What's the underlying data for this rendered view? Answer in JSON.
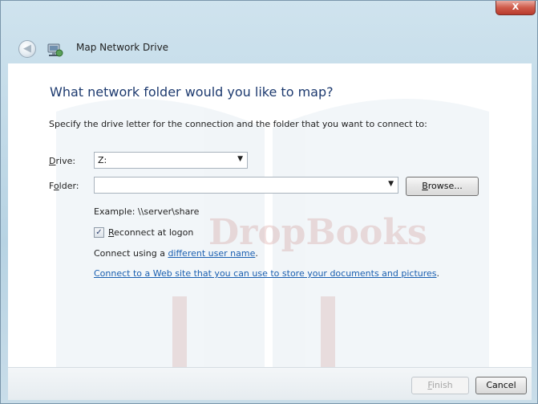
{
  "window": {
    "title": "Map Network Drive",
    "close_glyph": "X"
  },
  "titlebar": {
    "back_icon": "back-arrow-icon",
    "network_icon": "network-drive-icon"
  },
  "heading": "What network folder would you like to map?",
  "description": "Specify the drive letter for the connection and the folder that you want to connect to:",
  "drive": {
    "label_mnemonic": "D",
    "label_rest": "rive:",
    "value": "Z:"
  },
  "folder": {
    "label_prefix": "F",
    "label_mnemonic": "o",
    "label_rest": "lder:",
    "value": ""
  },
  "browse": {
    "mnemonic": "B",
    "rest": "rowse..."
  },
  "example_text": "Example: \\\\server\\share",
  "reconnect": {
    "checked": true,
    "mnemonic": "R",
    "rest": "econnect at logon"
  },
  "connect_using": {
    "prefix": "Connect using a ",
    "link": "different user name",
    "suffix": "."
  },
  "web_link": {
    "text": "Connect to a Web site that you can use to store your documents and pictures",
    "suffix": "."
  },
  "footer": {
    "finish": {
      "mnemonic": "F",
      "rest": "inish",
      "enabled": false
    },
    "cancel": "Cancel"
  },
  "watermark": "DropBooks",
  "colors": {
    "heading": "#1d3a6f",
    "link": "#1a5fb0",
    "watermark": "#b3403a"
  }
}
